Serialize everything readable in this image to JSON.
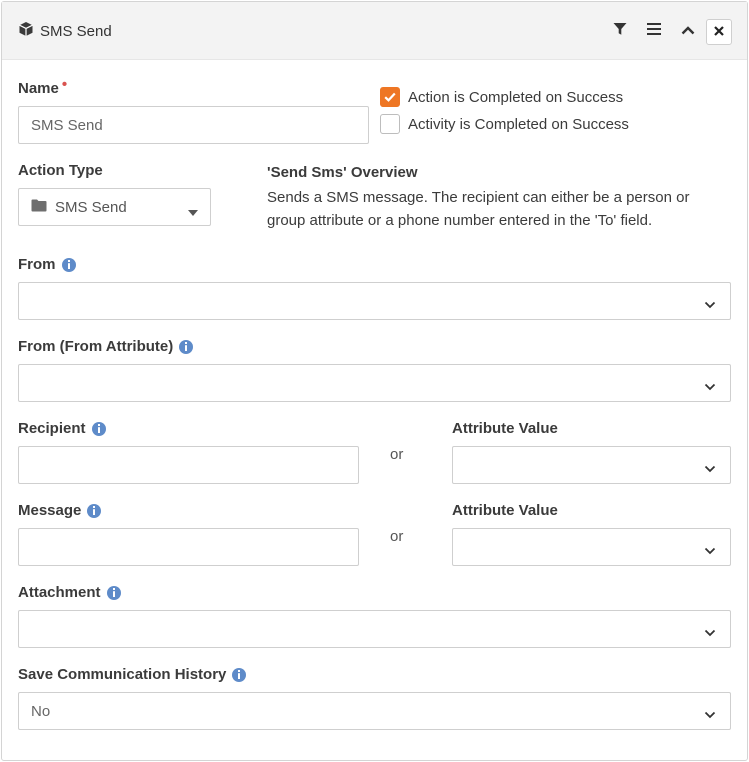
{
  "header": {
    "title": "SMS Send",
    "icons": [
      "cube-icon",
      "filter-icon",
      "menu-icon",
      "chevron-up-icon",
      "close-icon"
    ]
  },
  "name": {
    "label": "Name",
    "required_marker": "•",
    "value": "SMS Send"
  },
  "checkboxes": [
    {
      "label": "Action is Completed on Success",
      "checked": true
    },
    {
      "label": "Activity is Completed on Success",
      "checked": false
    }
  ],
  "action_type": {
    "label": "Action Type",
    "value": "SMS Send",
    "icon": "folder-icon"
  },
  "overview": {
    "title": "'Send Sms' Overview",
    "text": "Sends a SMS message. The recipient can either be a person or group attribute or a phone number entered in the 'To' field."
  },
  "fields": {
    "from": {
      "label": "From",
      "value": ""
    },
    "from_attribute": {
      "label": "From (From Attribute)",
      "value": ""
    },
    "recipient": {
      "label": "Recipient",
      "value": "",
      "or": "or",
      "attr_label": "Attribute Value",
      "attr_value": ""
    },
    "message": {
      "label": "Message",
      "value": "",
      "or": "or",
      "attr_label": "Attribute Value",
      "attr_value": ""
    },
    "attachment": {
      "label": "Attachment",
      "value": ""
    },
    "save_history": {
      "label": "Save Communication History",
      "value": "No"
    }
  },
  "colors": {
    "accent": "#ee7624",
    "info": "#5e8bc9",
    "required": "#d9534f",
    "header_bg": "#f3f3f3"
  }
}
